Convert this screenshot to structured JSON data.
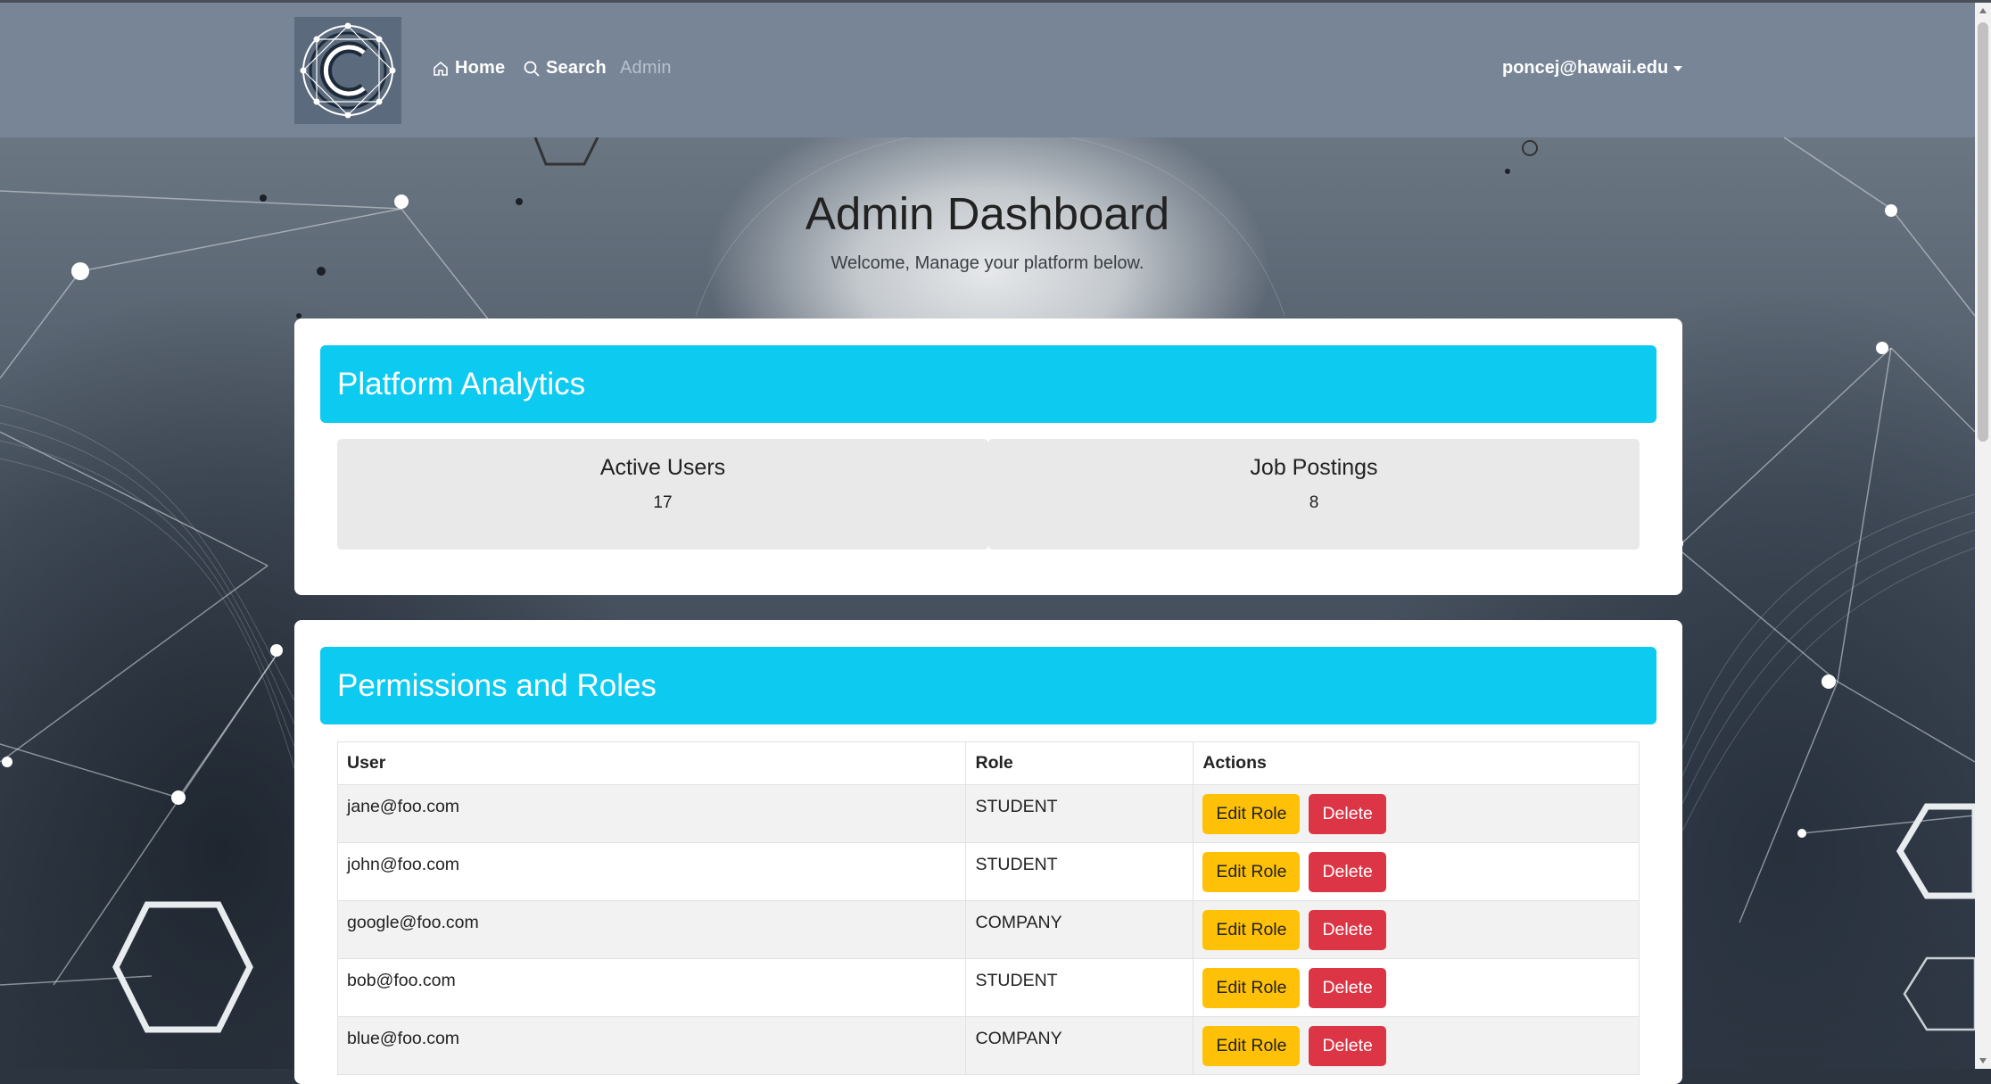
{
  "navbar": {
    "home_label": "Home",
    "search_label": "Search",
    "admin_label": "Admin",
    "user_email": "poncej@hawaii.edu"
  },
  "header": {
    "title": "Admin Dashboard",
    "subtitle": "Welcome, Manage your platform below."
  },
  "analytics": {
    "title": "Platform Analytics",
    "stats": [
      {
        "label": "Active Users",
        "value": "17"
      },
      {
        "label": "Job Postings",
        "value": "8"
      }
    ]
  },
  "permissions": {
    "title": "Permissions and Roles",
    "columns": [
      "User",
      "Role",
      "Actions"
    ],
    "edit_label": "Edit Role",
    "delete_label": "Delete",
    "rows": [
      {
        "user": "jane@foo.com",
        "role": "STUDENT"
      },
      {
        "user": "john@foo.com",
        "role": "STUDENT"
      },
      {
        "user": "google@foo.com",
        "role": "COMPANY"
      },
      {
        "user": "bob@foo.com",
        "role": "STUDENT"
      },
      {
        "user": "blue@foo.com",
        "role": "COMPANY"
      }
    ]
  },
  "colors": {
    "navbar": "#778596",
    "card_header": "#0dcaf0",
    "edit_button": "#ffc107",
    "delete_button": "#dc3545"
  }
}
